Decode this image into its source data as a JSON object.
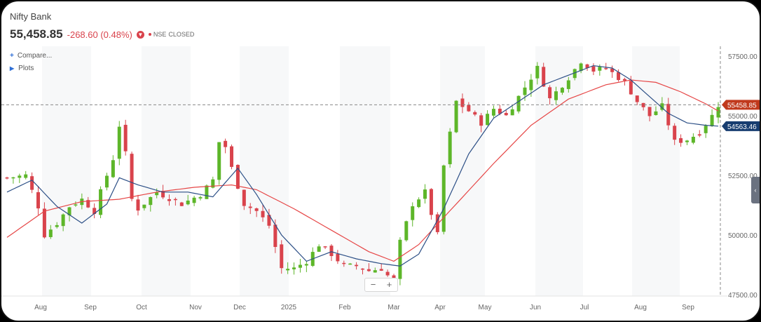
{
  "header": {
    "title": "Nifty Bank",
    "price": "55,458.85",
    "change": "-268.60 (0.48%)",
    "exchange": "NSE",
    "status": "CLOSED",
    "down_icon": "arrow-down-circle-icon"
  },
  "controls": {
    "compare_label": "Compare...",
    "plots_label": "Plots",
    "zoom_out": "−",
    "zoom_in": "+",
    "collapse_icon": "chevron-left-icon",
    "collapse_glyph": "‹"
  },
  "colors": {
    "up": "#5db629",
    "down": "#d9434c",
    "ma_fast": "#2c4f86",
    "ma_slow": "#e64646",
    "last_price_tag": "#c0391c",
    "ma_tag": "#173d70"
  },
  "chart_data": {
    "type": "candlestick",
    "title": "Nifty Bank",
    "x_tick_labels": [
      "Aug",
      "Sep",
      "Oct",
      "Nov",
      "Dec",
      "2025",
      "Feb",
      "Mar",
      "Apr",
      "May",
      "Jun",
      "Jul",
      "Aug",
      "Sep"
    ],
    "y_ticks": [
      47500,
      50000,
      52500,
      55000,
      57500
    ],
    "y_tick_labels": [
      "47500.00",
      "50000.00",
      "52500.00",
      "55000.00",
      "57500.00"
    ],
    "ylim": [
      47400,
      58000
    ],
    "period_count": 40,
    "close_anchors": [
      [
        0,
        52400
      ],
      [
        3,
        52500
      ],
      [
        5,
        51200
      ],
      [
        6,
        50000
      ],
      [
        8,
        50500
      ],
      [
        10,
        51200
      ],
      [
        12,
        51500
      ],
      [
        14,
        51000
      ],
      [
        15,
        51800
      ],
      [
        17,
        53200
      ],
      [
        18,
        54600
      ],
      [
        19,
        53400
      ],
      [
        20,
        51500
      ],
      [
        21,
        51100
      ],
      [
        24,
        51800
      ],
      [
        28,
        51300
      ],
      [
        31,
        51700
      ],
      [
        33,
        52300
      ],
      [
        34,
        53900
      ],
      [
        35,
        53700
      ],
      [
        36,
        52800
      ],
      [
        38,
        51300
      ],
      [
        40,
        51000
      ],
      [
        42,
        50400
      ],
      [
        44,
        48600
      ],
      [
        46,
        48600
      ],
      [
        48,
        48900
      ],
      [
        50,
        49600
      ],
      [
        52,
        49200
      ],
      [
        54,
        48700
      ],
      [
        56,
        48700
      ],
      [
        58,
        48500
      ],
      [
        60,
        48600
      ],
      [
        62,
        48000
      ],
      [
        63,
        49700
      ],
      [
        65,
        51300
      ],
      [
        67,
        51800
      ],
      [
        69,
        50000
      ],
      [
        70,
        52900
      ],
      [
        72,
        55600
      ],
      [
        74,
        55200
      ],
      [
        76,
        54700
      ],
      [
        78,
        55300
      ],
      [
        80,
        55000
      ],
      [
        82,
        55800
      ],
      [
        84,
        56600
      ],
      [
        85,
        57000
      ],
      [
        87,
        55700
      ],
      [
        90,
        56600
      ],
      [
        92,
        57300
      ],
      [
        94,
        56900
      ],
      [
        96,
        57000
      ],
      [
        99,
        56400
      ],
      [
        101,
        55600
      ],
      [
        103,
        55000
      ],
      [
        105,
        55400
      ],
      [
        107,
        53900
      ],
      [
        109,
        54000
      ],
      [
        111,
        54300
      ],
      [
        113,
        55000
      ],
      [
        114,
        55458.85
      ]
    ],
    "ma_fast_anchors": [
      [
        0,
        51800
      ],
      [
        4,
        52300
      ],
      [
        8,
        51200
      ],
      [
        12,
        50500
      ],
      [
        16,
        51300
      ],
      [
        18,
        52400
      ],
      [
        21,
        52100
      ],
      [
        25,
        51800
      ],
      [
        29,
        51800
      ],
      [
        33,
        51600
      ],
      [
        35,
        52200
      ],
      [
        37,
        52800
      ],
      [
        40,
        51700
      ],
      [
        44,
        50000
      ],
      [
        48,
        48900
      ],
      [
        52,
        49300
      ],
      [
        56,
        49000
      ],
      [
        60,
        48800
      ],
      [
        63,
        48700
      ],
      [
        66,
        49200
      ],
      [
        70,
        51100
      ],
      [
        74,
        53400
      ],
      [
        78,
        54900
      ],
      [
        82,
        55600
      ],
      [
        86,
        56300
      ],
      [
        90,
        56700
      ],
      [
        94,
        57100
      ],
      [
        97,
        57000
      ],
      [
        100,
        56500
      ],
      [
        103,
        55800
      ],
      [
        106,
        55100
      ],
      [
        109,
        54700
      ],
      [
        112,
        54600
      ],
      [
        114,
        54563.46
      ]
    ],
    "ma_slow_anchors": [
      [
        0,
        49900
      ],
      [
        6,
        51000
      ],
      [
        12,
        51400
      ],
      [
        18,
        51500
      ],
      [
        24,
        51800
      ],
      [
        30,
        52000
      ],
      [
        36,
        52100
      ],
      [
        40,
        51900
      ],
      [
        46,
        51100
      ],
      [
        52,
        50200
      ],
      [
        58,
        49300
      ],
      [
        62,
        48900
      ],
      [
        66,
        49600
      ],
      [
        72,
        51300
      ],
      [
        78,
        53000
      ],
      [
        84,
        54600
      ],
      [
        90,
        55700
      ],
      [
        96,
        56300
      ],
      [
        100,
        56500
      ],
      [
        104,
        56400
      ],
      [
        108,
        56000
      ],
      [
        112,
        55500
      ],
      [
        114,
        55200
      ]
    ],
    "last_price": 55458.85,
    "last_price_label": "55458.85",
    "ma_last": 54563.46,
    "ma_last_label": "54563.46",
    "grid": "vertical-bands",
    "crosshair": true
  }
}
